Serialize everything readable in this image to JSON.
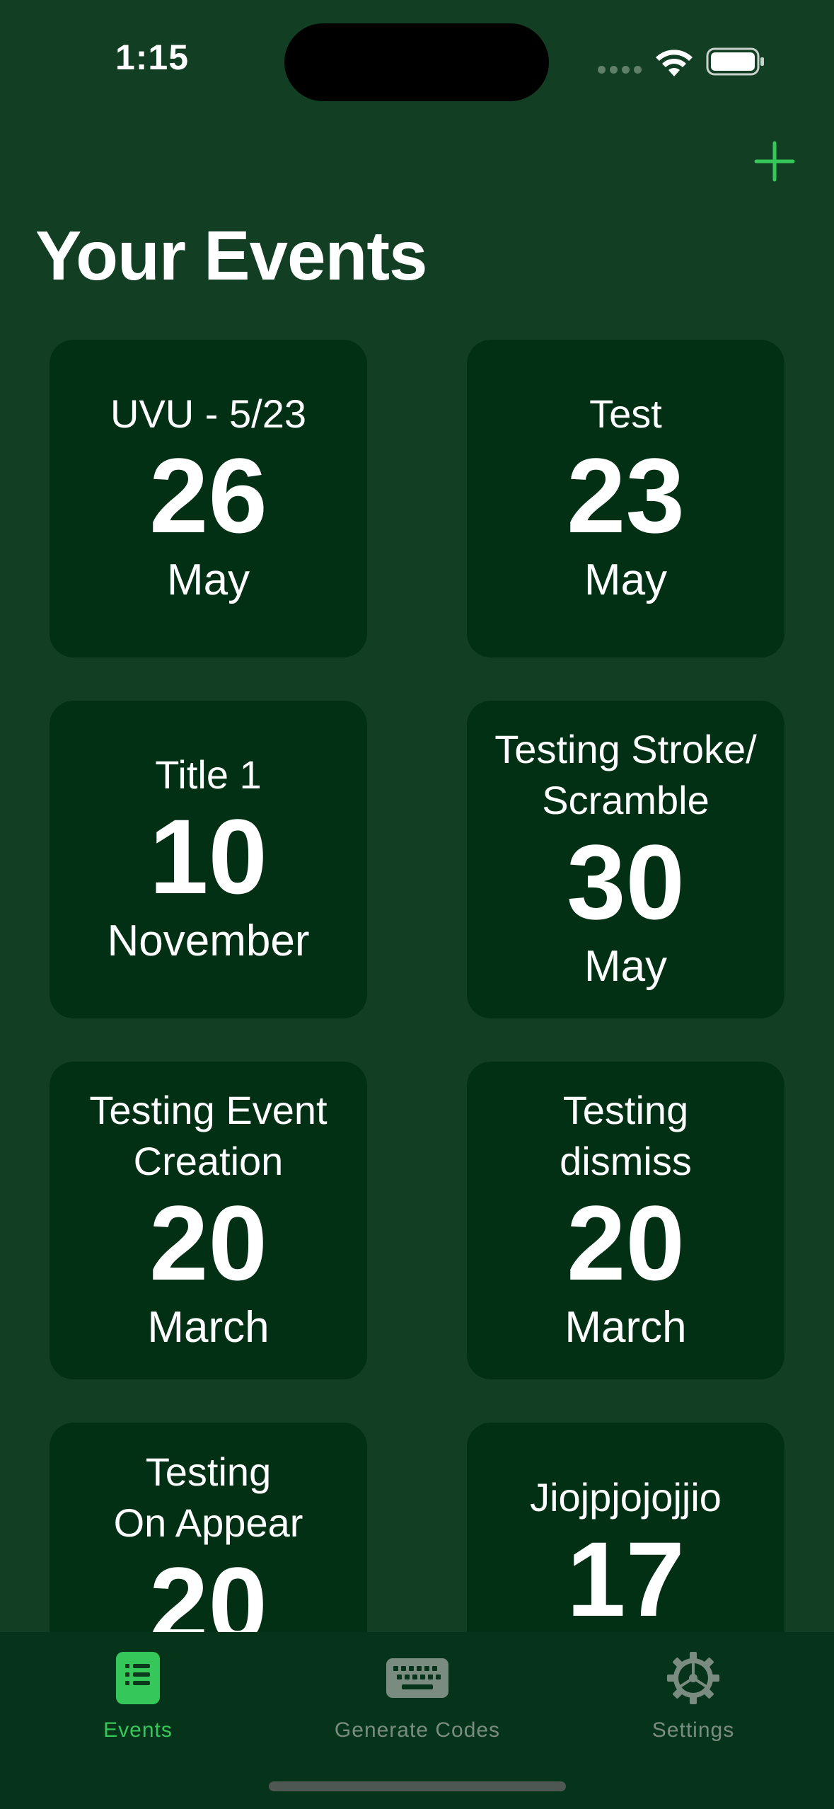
{
  "status_bar": {
    "time": "1:15"
  },
  "header": {
    "add_icon": "plus-icon",
    "title": "Your Events"
  },
  "events": [
    {
      "title": "UVU - 5/23",
      "day": "26",
      "month": "May"
    },
    {
      "title": "Test",
      "day": "23",
      "month": "May"
    },
    {
      "title": "Title 1",
      "day": "10",
      "month": "November"
    },
    {
      "title": "Testing Stroke/\nScramble",
      "day": "30",
      "month": "May"
    },
    {
      "title": "Testing Event\nCreation",
      "day": "20",
      "month": "March"
    },
    {
      "title": "Testing\ndismiss",
      "day": "20",
      "month": "March"
    },
    {
      "title": "Testing\nOn Appear",
      "day": "20",
      "month": ""
    },
    {
      "title": "Jiojpjojojjio",
      "day": "17",
      "month": ""
    }
  ],
  "tab_bar": {
    "tabs": [
      {
        "label": "Events",
        "icon": "list-icon",
        "active": true
      },
      {
        "label": "Generate Codes",
        "icon": "keyboard-icon",
        "active": false
      },
      {
        "label": "Settings",
        "icon": "gear-icon",
        "active": false
      }
    ]
  },
  "colors": {
    "background": "#123f24",
    "card": "#023015",
    "accent": "#35c759",
    "tab_bar": "#06341a",
    "inactive": "#7a8c80"
  }
}
